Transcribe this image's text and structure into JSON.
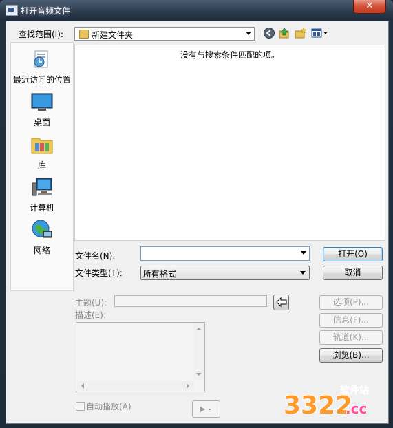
{
  "window": {
    "title": "打开音频文件",
    "close_glyph": "✕"
  },
  "toolbar": {
    "look_in_label": "查找范围(I):",
    "location": "新建文件夹"
  },
  "places": [
    {
      "label": "最近访问的位置",
      "icon": "recent-places-icon"
    },
    {
      "label": "桌面",
      "icon": "desktop-icon"
    },
    {
      "label": "库",
      "icon": "libraries-icon"
    },
    {
      "label": "计算机",
      "icon": "computer-icon"
    },
    {
      "label": "网络",
      "icon": "network-icon"
    }
  ],
  "file_list": {
    "empty_message": "没有与搜索条件匹配的项。"
  },
  "filename": {
    "label": "文件名(N):",
    "value": ""
  },
  "filetype": {
    "label": "文件类型(T):",
    "value": "所有格式"
  },
  "buttons": {
    "open": "打开(O)",
    "cancel": "取消",
    "options": "选项(P)...",
    "info": "信息(F)...",
    "tracks": "轨道(K)...",
    "browse": "浏览(B)..."
  },
  "meta": {
    "subject_label": "主题(U):",
    "description_label": "描述(E):"
  },
  "autoplay": {
    "label": "自动播放(A)",
    "checked": false
  },
  "watermark": {
    "text_top": "软件站",
    "text_digits": "3322",
    "text_suffix": ".cc"
  }
}
